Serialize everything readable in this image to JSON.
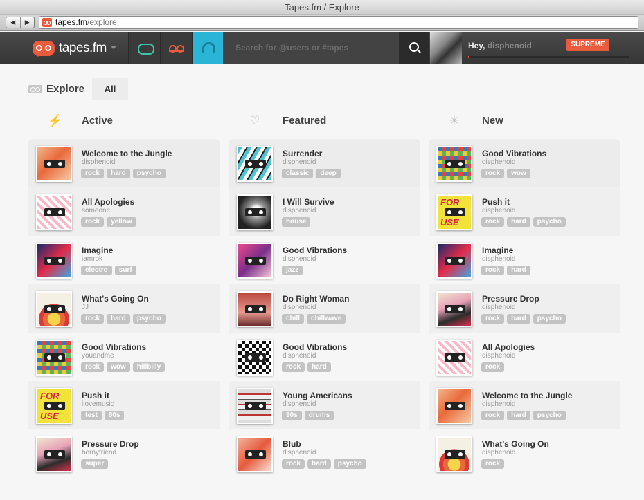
{
  "window": {
    "title": "Tapes.fm / Explore"
  },
  "browser": {
    "back": "◀",
    "forward": "▶",
    "url_host": "tapes.fm",
    "url_path": "/explore"
  },
  "header": {
    "logo_text": "tapes.fm",
    "search_placeholder": "Search for @users or #tapes",
    "greeting": "Hey,",
    "username": "disphenoid",
    "badge": "SUPREME",
    "progress_percent": 1,
    "accent": "#ea5a3c"
  },
  "explore": {
    "title": "Explore",
    "tab": "All"
  },
  "columns": [
    {
      "label": "Active",
      "icon": "lightning-icon",
      "items": [
        {
          "title": "Welcome to the Jungle",
          "user": "disphenoid",
          "tags": [
            "rock",
            "hard",
            "psycho"
          ],
          "art": "jungle"
        },
        {
          "title": "All Apologies",
          "user": "someone",
          "tags": [
            "rock",
            "yellow"
          ],
          "art": "apol"
        },
        {
          "title": "Imagine",
          "user": "iamrok",
          "tags": [
            "electro",
            "surf"
          ],
          "art": "imagine"
        },
        {
          "title": "What's Going On",
          "user": "JJ",
          "tags": [
            "rock",
            "hard",
            "psycho"
          ],
          "art": "going"
        },
        {
          "title": "Good Vibrations",
          "user": "youandme",
          "tags": [
            "rock",
            "wow",
            "hillbilly"
          ],
          "art": "good"
        },
        {
          "title": "Push it",
          "user": "ilovemusic",
          "tags": [
            "test",
            "80s"
          ],
          "art": "push"
        },
        {
          "title": "Pressure Drop",
          "user": "bernyfriend",
          "tags": [
            "super"
          ],
          "art": "pressure"
        }
      ]
    },
    {
      "label": "Featured",
      "icon": "heart-icon",
      "items": [
        {
          "title": "Surrender",
          "user": "disphenoid",
          "tags": [
            "classic",
            "deep"
          ],
          "art": "surrender"
        },
        {
          "title": "I Will Survive",
          "user": "disphenoid",
          "tags": [
            "house"
          ],
          "art": "survive"
        },
        {
          "title": "Good Vibrations",
          "user": "disphenoid",
          "tags": [
            "jazz"
          ],
          "art": "goodv2"
        },
        {
          "title": "Do Right Woman",
          "user": "disphenoid",
          "tags": [
            "chill",
            "chillwave"
          ],
          "art": "right"
        },
        {
          "title": "Good Vibrations",
          "user": "disphenoid",
          "tags": [
            "rock",
            "hard"
          ],
          "art": "goodv3"
        },
        {
          "title": "Young Americans",
          "user": "disphenoid",
          "tags": [
            "90s",
            "drums"
          ],
          "art": "young"
        },
        {
          "title": "Blub",
          "user": "disphenoid",
          "tags": [
            "rock",
            "hard",
            "psycho"
          ],
          "art": "blub"
        }
      ]
    },
    {
      "label": "New",
      "icon": "spinner-icon",
      "items": [
        {
          "title": "Good Vibrations",
          "user": "disphenoid",
          "tags": [
            "rock",
            "wow"
          ],
          "art": "good"
        },
        {
          "title": "Push it",
          "user": "disphenoid",
          "tags": [
            "rock",
            "hard",
            "psycho"
          ],
          "art": "push"
        },
        {
          "title": "Imagine",
          "user": "disphenoid",
          "tags": [
            "rock",
            "hard"
          ],
          "art": "imagine"
        },
        {
          "title": "Pressure Drop",
          "user": "disphenoid",
          "tags": [
            "rock",
            "hard",
            "psycho"
          ],
          "art": "pressure"
        },
        {
          "title": "All Apologies",
          "user": "disphenoid",
          "tags": [
            "rock"
          ],
          "art": "apol"
        },
        {
          "title": "Welcome to the Jungle",
          "user": "disphenoid",
          "tags": [
            "rock",
            "hard",
            "psycho"
          ],
          "art": "jungle"
        },
        {
          "title": "What's Going On",
          "user": "disphenoid",
          "tags": [
            "rock"
          ],
          "art": "going"
        }
      ]
    }
  ]
}
